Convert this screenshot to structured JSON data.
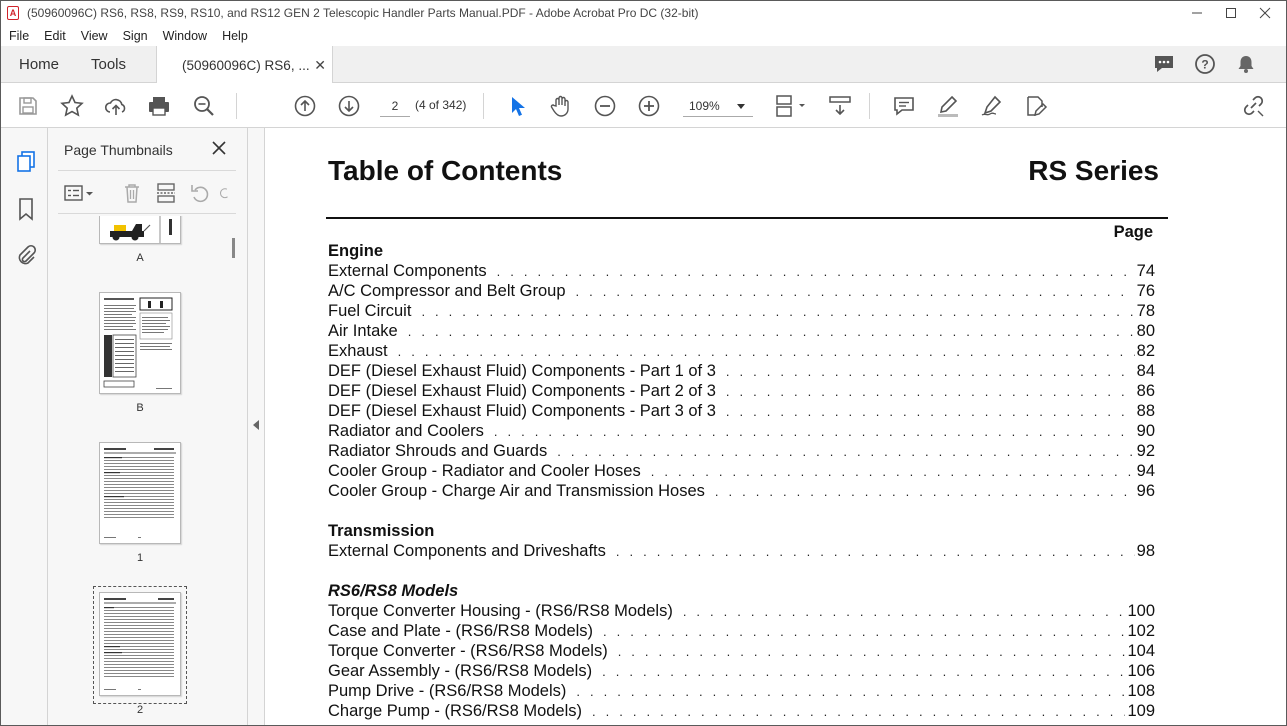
{
  "window": {
    "title": "(50960096C) RS6, RS8, RS9, RS10, and RS12 GEN 2 Telescopic Handler Parts Manual.PDF - Adobe Acrobat Pro DC (32-bit)"
  },
  "menu": [
    "File",
    "Edit",
    "View",
    "Sign",
    "Window",
    "Help"
  ],
  "tabs": {
    "home": "Home",
    "tools": "Tools",
    "document": "(50960096C) RS6, ..."
  },
  "toolbar": {
    "page_number": "2",
    "page_count": "(4 of 342)",
    "zoom": "109%"
  },
  "thumbnails_panel": {
    "title": "Page Thumbnails",
    "pages": [
      {
        "label": "A"
      },
      {
        "label": "B"
      },
      {
        "label": "1"
      },
      {
        "label": "2"
      }
    ]
  },
  "document": {
    "title": "Table of Contents",
    "series": "RS Series",
    "page_header": "Page",
    "sections": [
      {
        "heading": "Engine",
        "entries": [
          {
            "label": "External Components",
            "page": "74"
          },
          {
            "label": "A/C Compressor and Belt Group",
            "page": "76"
          },
          {
            "label": "Fuel Circuit",
            "page": "78"
          },
          {
            "label": "Air Intake",
            "page": "80"
          },
          {
            "label": "Exhaust",
            "page": "82"
          },
          {
            "label": "DEF (Diesel Exhaust Fluid) Components - Part 1 of 3",
            "page": "84"
          },
          {
            "label": "DEF (Diesel Exhaust Fluid) Components - Part 2 of 3",
            "page": "86"
          },
          {
            "label": "DEF (Diesel Exhaust Fluid) Components - Part 3 of 3",
            "page": "88"
          },
          {
            "label": "Radiator and Coolers",
            "page": "90"
          },
          {
            "label": "Radiator Shrouds and Guards",
            "page": "92"
          },
          {
            "label": "Cooler Group - Radiator and Cooler Hoses",
            "page": "94"
          },
          {
            "label": "Cooler Group - Charge Air and Transmission Hoses",
            "page": "96"
          }
        ]
      },
      {
        "heading": "Transmission",
        "entries": [
          {
            "label": "External Components and Driveshafts",
            "page": "98"
          }
        ]
      },
      {
        "heading": "RS6/RS8 Models",
        "entries": [
          {
            "label": "Torque Converter Housing - (RS6/RS8 Models)",
            "page": "100"
          },
          {
            "label": "Case and Plate - (RS6/RS8 Models)",
            "page": "102"
          },
          {
            "label": "Torque Converter - (RS6/RS8 Models)",
            "page": "104"
          },
          {
            "label": "Gear Assembly  - (RS6/RS8 Models)",
            "page": "106"
          },
          {
            "label": "Pump Drive - (RS6/RS8 Models)",
            "page": "108"
          },
          {
            "label": "Charge Pump - (RS6/RS8 Models)",
            "page": "109"
          }
        ]
      }
    ]
  }
}
